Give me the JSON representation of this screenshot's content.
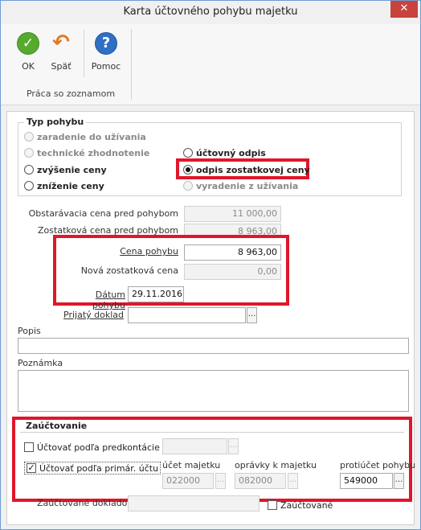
{
  "window": {
    "title": "Karta účtovného pohybu majetku",
    "close_glyph": "✕"
  },
  "toolbar": {
    "ok_label": "OK",
    "back_label": "Späť",
    "help_label": "Pomoc",
    "group_label": "Práca so zoznamom",
    "icons": {
      "ok": "check-circle-icon",
      "back": "undo-arrow-icon",
      "help": "question-circle-icon"
    }
  },
  "movement_type": {
    "title": "Typ pohybu",
    "options": [
      {
        "label": "zaradenie do užívania",
        "enabled": false,
        "selected": false
      },
      {
        "label": "technické zhodnotenie",
        "enabled": false,
        "selected": false
      },
      {
        "label": "zvýšenie ceny",
        "enabled": true,
        "selected": false
      },
      {
        "label": "zníženie ceny",
        "enabled": true,
        "selected": false
      },
      {
        "label": "účtovný odpis",
        "enabled": true,
        "selected": false
      },
      {
        "label": "odpis zostatkovej ceny",
        "enabled": true,
        "selected": true
      },
      {
        "label": "vyradenie z užívania",
        "enabled": false,
        "selected": false
      }
    ]
  },
  "values": {
    "acquisition_label": "Obstarávacia cena pred pohybom",
    "acquisition_value": "11 000,00",
    "residual_label": "Zostatková cena pred pohybom",
    "residual_value": "8 963,00",
    "price_label": "Cena pohybu",
    "price_value": "8 963,00",
    "new_residual_label": "Nová zostatková cena",
    "new_residual_value": "0,00",
    "date_label": "Dátum pohybu",
    "date_value": "29.11.2016",
    "document_label": "Prijatý doklad",
    "document_value": "",
    "dots": "..."
  },
  "notes": {
    "popis_label": "Popis",
    "popis_value": "",
    "poznamka_label": "Poznámka",
    "poznamka_value": ""
  },
  "accounting": {
    "title": "Zaúčtovanie",
    "by_template_label": "Účtovať podľa predkontácie",
    "by_template_checked": false,
    "by_primary_label": "Účtovať podľa primár. účtu",
    "by_primary_checked": true,
    "check_glyph": "✓",
    "asset_account_label": "účet majetku",
    "asset_account_value": "022000",
    "depreciation_label": "oprávky k majetku",
    "depreciation_value": "082000",
    "contra_label": "protiúčet pohybu",
    "contra_value": "549000",
    "posted_docs_label": "Zaúčtované dokladom",
    "posted_docs_value": "",
    "posted_label": "Zaúčtované",
    "posted_checked": false
  }
}
